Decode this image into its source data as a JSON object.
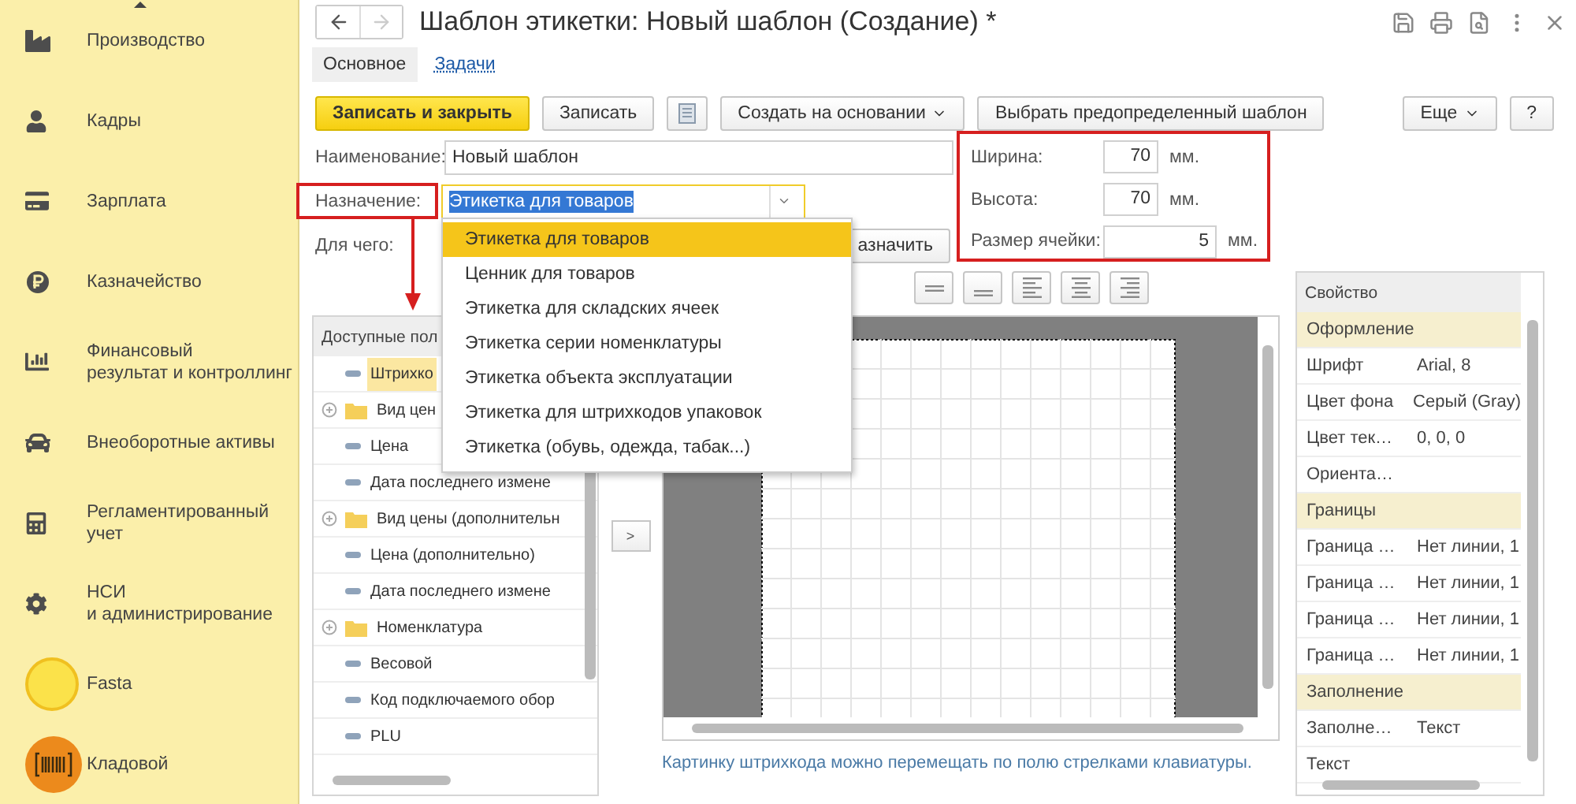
{
  "sidebar": {
    "items": [
      {
        "label": "Производство"
      },
      {
        "label": "Кадры"
      },
      {
        "label": "Зарплата"
      },
      {
        "label": "Казначейство"
      },
      {
        "label": "Финансовый\nрезультат и контроллинг"
      },
      {
        "label": "Внеоборотные активы"
      },
      {
        "label": "Регламентированный\nучет"
      },
      {
        "label": "НСИ\nи администрирование"
      },
      {
        "label": "Fasta"
      },
      {
        "label": "Кладовой"
      }
    ]
  },
  "window": {
    "title": "Шаблон этикетки: Новый шаблон (Создание) *",
    "nav_buttons": [
      {
        "kind": "back",
        "disabled": false
      },
      {
        "kind": "forward",
        "disabled": true
      }
    ]
  },
  "tabs": [
    {
      "label": "Основное",
      "selected": true
    },
    {
      "label": "Задачи",
      "selected": false
    }
  ],
  "toolbar": {
    "buttons": [
      {
        "kind": "primary",
        "label": "Записать и закрыть"
      },
      {
        "kind": "plain",
        "label": "Записать"
      },
      {
        "kind": "icon"
      },
      {
        "kind": "menu",
        "label": "Создать на основании"
      },
      {
        "kind": "plain",
        "label": "Выбрать предопределенный шаблон"
      }
    ],
    "right_buttons": [
      {
        "kind": "menu",
        "label": "Еще"
      },
      {
        "kind": "plain",
        "label": "?"
      }
    ]
  },
  "form": {
    "name": {
      "label": "Наименование:",
      "value": "Новый шаблон"
    },
    "purpose": {
      "label": "Назначение:",
      "value": "Этикетка для товаров",
      "value_selected": true,
      "annotated": true
    },
    "for_what": {
      "label": "Для чего:",
      "button": "азначить"
    }
  },
  "size": {
    "annotated": true,
    "rows": [
      {
        "label": "Ширина:",
        "value": "70",
        "unit": "мм."
      },
      {
        "label": "Высота:",
        "value": "70",
        "unit": "мм."
      },
      {
        "label": "Размер ячейки:",
        "value": "5",
        "unit": "мм."
      }
    ]
  },
  "dropdown": {
    "items": [
      {
        "label": "Этикетка для товаров",
        "selected": true
      },
      {
        "label": "Ценник для товаров",
        "selected": false
      },
      {
        "label": "Этикетка для складских ячеек",
        "selected": false
      },
      {
        "label": "Этикетка серии номенклатуры",
        "selected": false
      },
      {
        "label": "Этикетка объекта эксплуатации",
        "selected": false
      },
      {
        "label": "Этикетка для штрихкодов упаковок",
        "selected": false
      },
      {
        "label": "Этикетка (обувь, одежда, табак...)",
        "selected": false
      }
    ]
  },
  "fields_panel": {
    "header": "Доступные пол",
    "items": [
      {
        "kind": "field",
        "label": "Штрихко",
        "selected": true
      },
      {
        "kind": "group",
        "label": "Вид цен",
        "selected": false
      },
      {
        "kind": "field",
        "label": "Цена",
        "selected": false
      },
      {
        "kind": "field",
        "label": "Дата последнего измене",
        "selected": false
      },
      {
        "kind": "group",
        "label": "Вид цены (дополнительн",
        "selected": false
      },
      {
        "kind": "field",
        "label": "Цена (дополнительно)",
        "selected": false
      },
      {
        "kind": "field",
        "label": "Дата последнего измене",
        "selected": false
      },
      {
        "kind": "group",
        "label": "Номенклатура",
        "selected": false
      },
      {
        "kind": "field",
        "label": "Весовой",
        "selected": false
      },
      {
        "kind": "field",
        "label": "Код подключаемого обор",
        "selected": false
      },
      {
        "kind": "field",
        "label": "PLU",
        "selected": false
      }
    ]
  },
  "move_button": ">",
  "canvas_hint": "Картинку штрихкода можно перемещать по полю стрелками клавиатуры.",
  "properties": {
    "header": "Свойство",
    "rows": [
      {
        "kind": "group",
        "name": "Оформление"
      },
      {
        "kind": "property",
        "name": "Шрифт",
        "value": "Arial, 8"
      },
      {
        "kind": "property",
        "name": "Цвет фона",
        "value": "Серый (Gray)"
      },
      {
        "kind": "property",
        "name": "Цвет тек…",
        "value": "0, 0, 0"
      },
      {
        "kind": "property",
        "name": "Ориента…"
      },
      {
        "kind": "group",
        "name": "Границы"
      },
      {
        "kind": "property",
        "name": "Граница …",
        "value": "Нет линии, 1"
      },
      {
        "kind": "property",
        "name": "Граница …",
        "value": "Нет линии, 1"
      },
      {
        "kind": "property",
        "name": "Граница …",
        "value": "Нет линии, 1"
      },
      {
        "kind": "property",
        "name": "Граница …",
        "value": "Нет линии, 1"
      },
      {
        "kind": "group",
        "name": "Заполнение"
      },
      {
        "kind": "property",
        "name": "Заполне…",
        "value": "Текст"
      },
      {
        "kind": "property",
        "name": "Текст"
      }
    ]
  }
}
